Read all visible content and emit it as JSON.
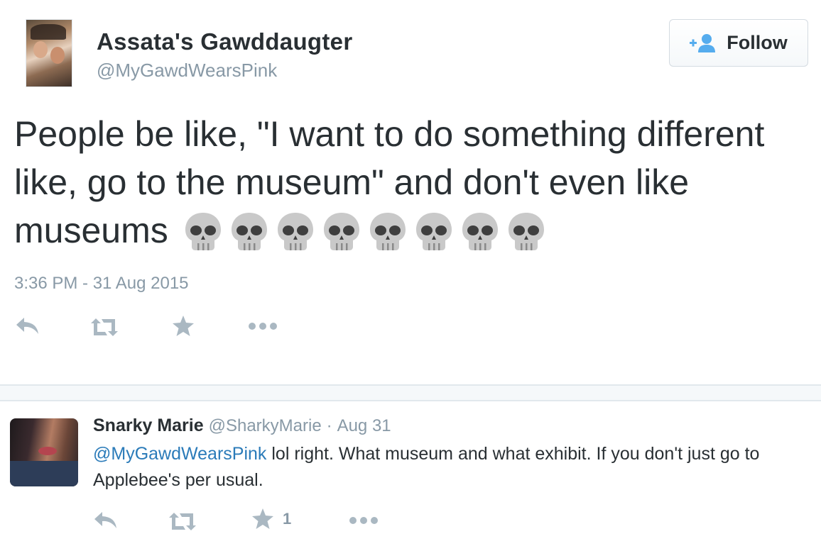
{
  "tweet": {
    "author_name": "Assata's Gawddaugter",
    "author_handle": "@MyGawdWearsPink",
    "follow_label": "Follow",
    "text": "People be like, \"I want to do something different like, go to the museum\" and don't even like museums",
    "emoji": [
      "skull",
      "skull",
      "skull",
      "skull",
      "skull",
      "skull",
      "skull",
      "skull"
    ],
    "timestamp": "3:36 PM - 31 Aug 2015",
    "actions": [
      "reply-icon",
      "retweet-icon",
      "favorite-icon",
      "more-icon"
    ]
  },
  "reply": {
    "author_name": "Snarky Marie",
    "author_handle": "@SharkyMarie",
    "separator": "·",
    "date": "Aug 31",
    "mention": "@MyGawdWearsPink",
    "text": " lol right. What museum and what exhibit. If you don't just go to Applebee's per usual.",
    "favorite_count": "1",
    "actions": [
      "reply-icon",
      "retweet-icon",
      "favorite-icon",
      "more-icon"
    ]
  },
  "colors": {
    "text": "#292f33",
    "muted": "#8899a6",
    "link": "#2b7bb9",
    "icon": "#aab8c2",
    "follow_icon": "#55acee"
  }
}
